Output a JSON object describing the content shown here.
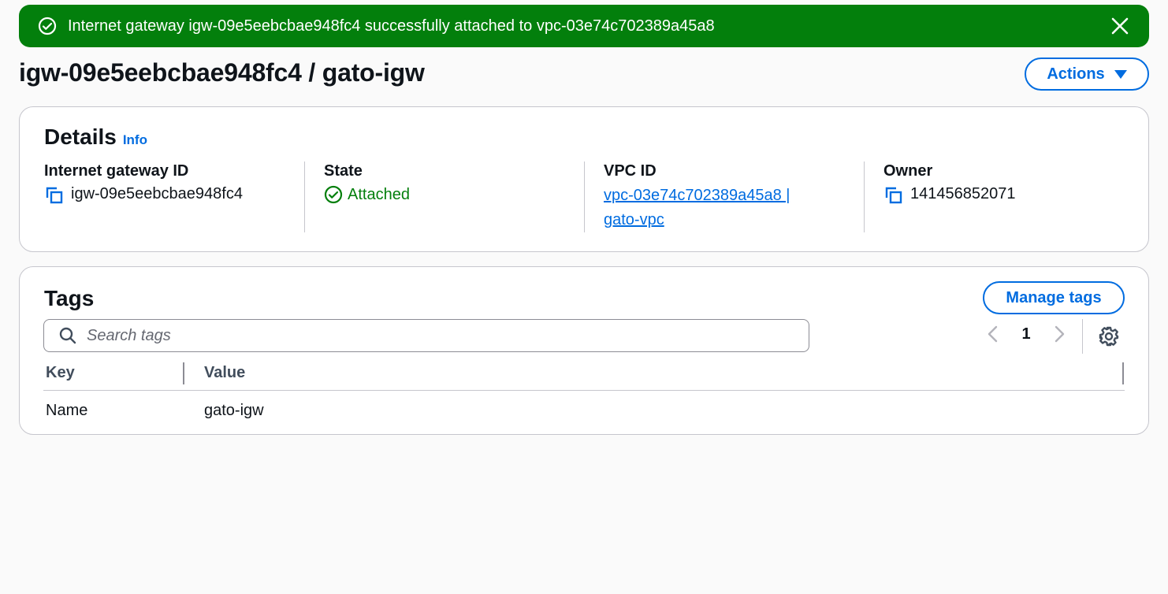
{
  "flash": {
    "message": "Internet gateway igw-09e5eebcbae948fc4 successfully attached to vpc-03e74c702389a45a8",
    "color": "#037f0c"
  },
  "header": {
    "title": "igw-09e5eebcbae948fc4 / gato-igw",
    "actions_label": "Actions"
  },
  "details": {
    "heading": "Details",
    "info_label": "Info",
    "columns": [
      {
        "label": "Internet gateway ID",
        "value": "igw-09e5eebcbae948fc4"
      },
      {
        "label": "State",
        "value": "Attached"
      },
      {
        "label": "VPC ID",
        "value": "vpc-03e74c702389a45a8 | gato-vpc"
      },
      {
        "label": "Owner",
        "value": "141456852071"
      }
    ]
  },
  "tags": {
    "heading": "Tags",
    "manage_label": "Manage tags",
    "search_placeholder": "Search tags",
    "page": "1",
    "columns": [
      "Key",
      "Value"
    ],
    "rows": [
      {
        "key": "Name",
        "value": "gato-igw"
      }
    ]
  },
  "colors": {
    "accent": "#006ce0",
    "success": "#037f0c",
    "border": "#c6c6cd"
  }
}
